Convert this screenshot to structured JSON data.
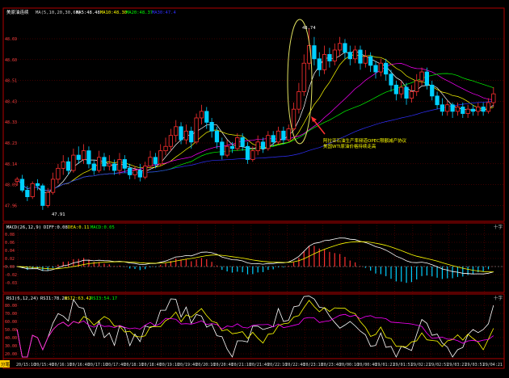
{
  "colors": {
    "background": "#000000",
    "up": "#ff3030",
    "down": "#00d0ff",
    "border": "#b00000",
    "ma5": "#ffffff",
    "ma10": "#ffff00",
    "ma20": "#ff00ff",
    "ma30": "#00ff00",
    "ma60": "#3030ff",
    "dif": "#ffffff",
    "dea": "#ffff00",
    "macd": "#ff00ff",
    "rsi1": "#ffffff",
    "rsi2": "#ffff00",
    "rsi3": "#ff00ff"
  },
  "top_legend": {
    "name": "美原油连续",
    "ma_label": "MA(5,10,20,30,60)",
    "ma5": "MA5:48.48",
    "ma10": "MA10:48.30",
    "ma20": "MA20:48.37",
    "ma30": "MA30:47.4"
  },
  "price_ticks": [
    "48.69",
    "48.60",
    "48.51",
    "48.43",
    "48.33",
    "48.23",
    "48.14",
    "48.05",
    "47.96"
  ],
  "high_label": "48.74",
  "low_label": "47.91",
  "annotation": {
    "line1": "阿拉亚石油生产率频道OPEC限额减产协议",
    "line2": "美国WTI原油价格持续走高"
  },
  "macd_legend": {
    "label": "MACD(26,12,9)",
    "dif": "DIFF:0.08",
    "dea": "DEA:0.11",
    "macd": "MACD:0.05"
  },
  "macd_ticks": [
    "0.08",
    "0.06",
    "0.04",
    "0.02",
    "0.00",
    "-0.02",
    "-0.03"
  ],
  "rsi_legend": {
    "label": "RSI(6,12,24)",
    "rsi1": "RSI1:78.28",
    "rsi2": "RSI2:63.42",
    "rsi3": "RSI3:54.17"
  },
  "rsi_ticks": [
    "80.00",
    "70.00",
    "60.00",
    "50.00",
    "40.00",
    "30.00",
    "20.00"
  ],
  "x_ticks": [
    "20/15:10",
    "20/15:40",
    "20/16:10",
    "20/16:40",
    "20/17:10",
    "20/17:40",
    "20/18:10",
    "20/18:40",
    "20/19:10",
    "20/19:40",
    "20/20:10",
    "20/20:40",
    "20/21:10",
    "20/21:40",
    "20/22:10",
    "20/22:40",
    "20/23:10",
    "20/23:40",
    "20/00:10",
    "20/00:40",
    "29/01:21",
    "29/01:51",
    "29/02:21",
    "29/02:51",
    "29/03:21",
    "29/03:51",
    "29/04:21"
  ],
  "corner_right": "十字",
  "corner_left": "分笔",
  "chart_data": {
    "type": "candlestick",
    "price_range": [
      47.88,
      48.78
    ],
    "candles": [
      [
        48.04,
        48.05,
        48.02,
        48.06
      ],
      [
        48.05,
        48.0,
        47.99,
        48.07
      ],
      [
        48.0,
        47.97,
        47.95,
        48.02
      ],
      [
        47.97,
        48.03,
        47.96,
        48.04
      ],
      [
        48.03,
        48.02,
        48.0,
        48.05
      ],
      [
        48.02,
        47.93,
        47.91,
        48.03
      ],
      [
        47.93,
        47.99,
        47.92,
        48.01
      ],
      [
        47.99,
        48.05,
        47.98,
        48.08
      ],
      [
        48.05,
        48.1,
        48.03,
        48.12
      ],
      [
        48.1,
        48.13,
        48.07,
        48.16
      ],
      [
        48.13,
        48.09,
        48.07,
        48.15
      ],
      [
        48.09,
        48.16,
        48.08,
        48.19
      ],
      [
        48.16,
        48.14,
        48.12,
        48.2
      ],
      [
        48.14,
        48.18,
        48.12,
        48.21
      ],
      [
        48.18,
        48.12,
        48.1,
        48.2
      ],
      [
        48.12,
        48.09,
        48.07,
        48.14
      ],
      [
        48.09,
        48.15,
        48.08,
        48.18
      ],
      [
        48.15,
        48.11,
        48.09,
        48.17
      ],
      [
        48.11,
        48.12,
        48.09,
        48.16
      ],
      [
        48.12,
        48.09,
        48.07,
        48.14
      ],
      [
        48.09,
        48.14,
        48.07,
        48.17
      ],
      [
        48.14,
        48.1,
        48.08,
        48.16
      ],
      [
        48.1,
        48.07,
        48.05,
        48.12
      ],
      [
        48.07,
        48.09,
        48.05,
        48.11
      ],
      [
        48.09,
        48.06,
        48.04,
        48.12
      ],
      [
        48.06,
        48.11,
        48.05,
        48.13
      ],
      [
        48.11,
        48.15,
        48.1,
        48.18
      ],
      [
        48.15,
        48.12,
        48.1,
        48.17
      ],
      [
        48.12,
        48.18,
        48.11,
        48.21
      ],
      [
        48.18,
        48.2,
        48.16,
        48.24
      ],
      [
        48.2,
        48.25,
        48.18,
        48.28
      ],
      [
        48.25,
        48.29,
        48.22,
        48.32
      ],
      [
        48.29,
        48.23,
        48.21,
        48.31
      ],
      [
        48.23,
        48.27,
        48.21,
        48.3
      ],
      [
        48.27,
        48.22,
        48.19,
        48.29
      ],
      [
        48.22,
        48.33,
        48.21,
        48.35
      ],
      [
        48.33,
        48.36,
        48.3,
        48.39
      ],
      [
        48.36,
        48.31,
        48.28,
        48.38
      ],
      [
        48.31,
        48.27,
        48.24,
        48.33
      ],
      [
        48.27,
        48.22,
        48.19,
        48.29
      ],
      [
        48.22,
        48.16,
        48.14,
        48.24
      ],
      [
        48.16,
        48.2,
        48.15,
        48.23
      ],
      [
        48.2,
        48.19,
        48.17,
        48.22
      ],
      [
        48.19,
        48.24,
        48.18,
        48.26
      ],
      [
        48.24,
        48.2,
        48.18,
        48.26
      ],
      [
        48.2,
        48.14,
        48.12,
        48.22
      ],
      [
        48.14,
        48.18,
        48.13,
        48.2
      ],
      [
        48.18,
        48.22,
        48.16,
        48.25
      ],
      [
        48.22,
        48.19,
        48.17,
        48.24
      ],
      [
        48.19,
        48.25,
        48.18,
        48.27
      ],
      [
        48.25,
        48.22,
        48.2,
        48.27
      ],
      [
        48.22,
        48.27,
        48.21,
        48.29
      ],
      [
        48.27,
        48.23,
        48.21,
        48.29
      ],
      [
        48.23,
        48.28,
        48.22,
        48.3
      ],
      [
        48.28,
        48.37,
        48.27,
        48.4
      ],
      [
        48.37,
        48.45,
        48.35,
        48.49
      ],
      [
        48.45,
        48.58,
        48.43,
        48.62
      ],
      [
        48.58,
        48.66,
        48.55,
        48.74
      ],
      [
        48.66,
        48.6,
        48.57,
        48.7
      ],
      [
        48.6,
        48.55,
        48.52,
        48.63
      ],
      [
        48.55,
        48.62,
        48.53,
        48.66
      ],
      [
        48.62,
        48.59,
        48.56,
        48.65
      ],
      [
        48.59,
        48.64,
        48.57,
        48.67
      ],
      [
        48.64,
        48.67,
        48.61,
        48.7
      ],
      [
        48.67,
        48.63,
        48.6,
        48.69
      ],
      [
        48.63,
        48.6,
        48.57,
        48.66
      ],
      [
        48.6,
        48.64,
        48.58,
        48.66
      ],
      [
        48.64,
        48.58,
        48.55,
        48.66
      ],
      [
        48.58,
        48.61,
        48.56,
        48.64
      ],
      [
        48.61,
        48.57,
        48.54,
        48.63
      ],
      [
        48.57,
        48.54,
        48.51,
        48.59
      ],
      [
        48.54,
        48.58,
        48.52,
        48.6
      ],
      [
        48.58,
        48.53,
        48.5,
        48.6
      ],
      [
        48.53,
        48.48,
        48.45,
        48.55
      ],
      [
        48.48,
        48.44,
        48.41,
        48.5
      ],
      [
        48.44,
        48.47,
        48.42,
        48.5
      ],
      [
        48.47,
        48.42,
        48.39,
        48.49
      ],
      [
        48.42,
        48.45,
        48.4,
        48.48
      ],
      [
        48.45,
        48.5,
        48.43,
        48.53
      ],
      [
        48.5,
        48.54,
        48.48,
        48.56
      ],
      [
        48.54,
        48.48,
        48.46,
        48.56
      ],
      [
        48.48,
        48.43,
        48.41,
        48.5
      ],
      [
        48.43,
        48.39,
        48.37,
        48.45
      ],
      [
        48.39,
        48.36,
        48.34,
        48.42
      ],
      [
        48.36,
        48.39,
        48.34,
        48.41
      ],
      [
        48.39,
        48.36,
        48.33,
        48.4
      ],
      [
        48.36,
        48.38,
        48.34,
        48.4
      ],
      [
        48.38,
        48.35,
        48.33,
        48.4
      ],
      [
        48.35,
        48.37,
        48.33,
        48.39
      ],
      [
        48.37,
        48.36,
        48.34,
        48.39
      ],
      [
        48.36,
        48.38,
        48.34,
        48.4
      ],
      [
        48.38,
        48.36,
        48.34,
        48.4
      ],
      [
        48.36,
        48.4,
        48.35,
        48.42
      ],
      [
        48.4,
        48.44,
        48.38,
        48.47
      ]
    ]
  }
}
